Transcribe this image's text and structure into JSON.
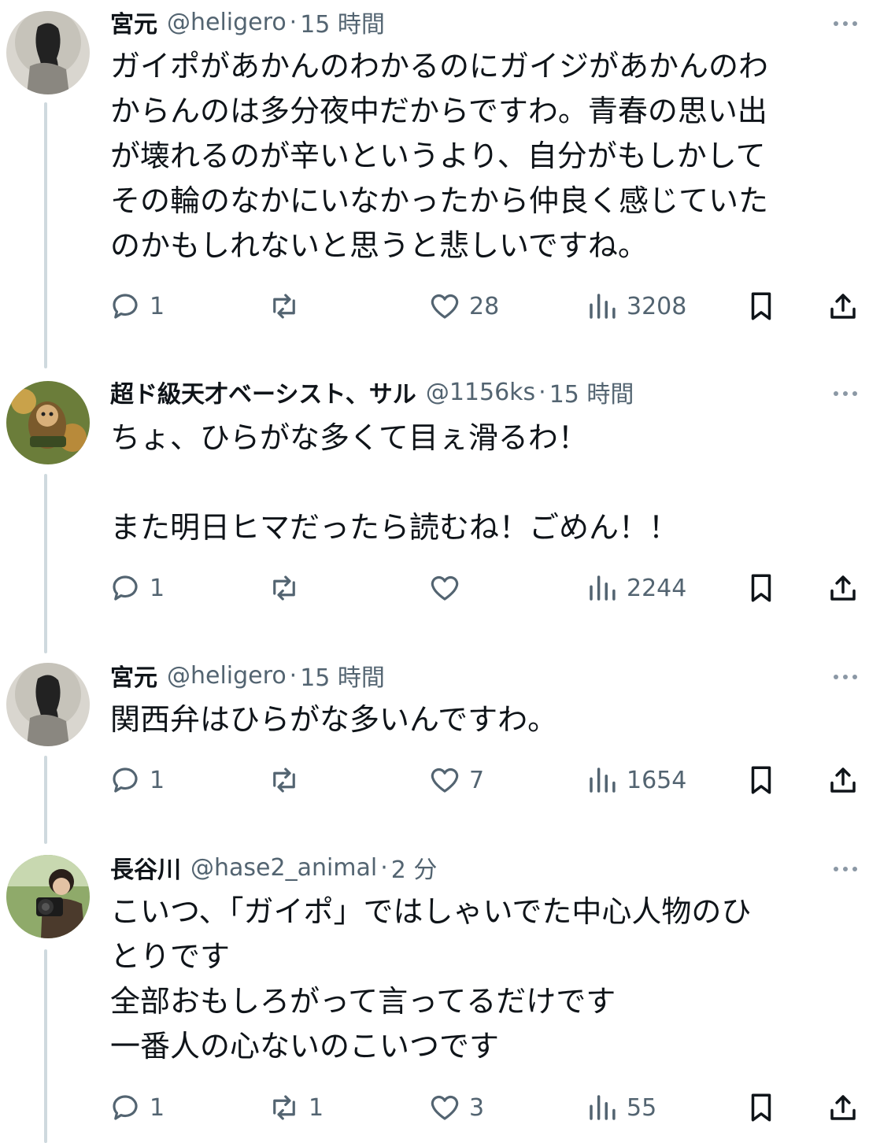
{
  "tweets": [
    {
      "name": "宮元",
      "handle": "@heligero",
      "separator": "·",
      "time": "15 時間",
      "text": "ガイポがあかんのわかるのにガイジがあかんのわ\nからんのは多分夜中だからですわ。青春の思い出\nが壊れるのが辛いというより、自分がもしかして\nその輪のなかにいなかったから仲良く感じていた\nのかもしれないと思うと悲しいですね。",
      "avatar_icon": "dark-haired-figure-avatar",
      "replies": "1",
      "reposts": "",
      "likes": "28",
      "views": "3208"
    },
    {
      "name": "超ド級天才ベーシスト、サル",
      "handle": "@1156ks",
      "separator": "·",
      "time": "15 時間",
      "text": "ちょ、ひらがな多くて目ぇ滑るわ！\n\nまた明日ヒマだったら読むね！ごめん！！",
      "avatar_icon": "monkey-character-avatar",
      "replies": "1",
      "reposts": "",
      "likes": "",
      "views": "2244"
    },
    {
      "name": "宮元",
      "handle": "@heligero",
      "separator": "·",
      "time": "15 時間",
      "text": "関西弁はひらがな多いんですわ。",
      "avatar_icon": "dark-haired-figure-avatar",
      "replies": "1",
      "reposts": "",
      "likes": "7",
      "views": "1654"
    },
    {
      "name": "長谷川",
      "handle": "@hase2_animal",
      "separator": "·",
      "time": "2 分",
      "text": "こいつ、「ガイポ」ではしゃいでた中心人物のひ\nとりです\n全部おもしろがって言ってるだけです\n一番人の心ないのこいつです",
      "avatar_icon": "camera-person-avatar",
      "replies": "1",
      "reposts": "1",
      "likes": "3",
      "views": "55"
    }
  ],
  "icons": {
    "reply": "reply-icon",
    "repost": "repost-icon",
    "like": "like-icon",
    "views": "views-icon",
    "bookmark": "bookmark-icon",
    "share": "share-icon",
    "more": "more-icon"
  },
  "colors": {
    "text": "#0f1419",
    "secondary": "#536471",
    "thread_line": "#cfd9de",
    "background": "#ffffff"
  }
}
